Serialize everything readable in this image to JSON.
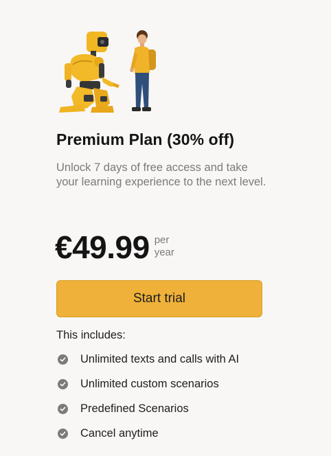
{
  "plan": {
    "title": "Premium Plan (30% off)",
    "description": "Unlock 7 days of free access and take your learning experience to the next level.",
    "price": "€49.99",
    "period_line1": "per",
    "period_line2": "year"
  },
  "cta": {
    "label": "Start trial"
  },
  "includes": {
    "heading": "This includes:",
    "items": [
      {
        "label": "Unlimited texts and calls with AI",
        "icon": "check-circle-icon"
      },
      {
        "label": "Unlimited custom scenarios",
        "icon": "check-circle-icon"
      },
      {
        "label": "Predefined Scenarios",
        "icon": "check-circle-icon"
      },
      {
        "label": "Cancel anytime",
        "icon": "check-circle-icon"
      }
    ]
  },
  "colors": {
    "background": "#f8f7f5",
    "accent": "#efb13a",
    "check": "#7b7b7b"
  }
}
